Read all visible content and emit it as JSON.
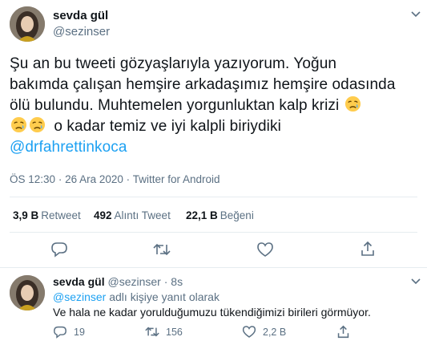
{
  "main_tweet": {
    "display_name": "sevda gül",
    "handle": "@sezinser",
    "text_line1": "Şu an bu tweeti gözyaşlarıyla yazıyorum. Yoğun",
    "text_line2": "bakımda çalışan hemşire arkadaşımız hemşire odasında",
    "text_line3": "ölü bulundu. Muhtemelen yorgunluktan kalp krizi",
    "text_line4": "o kadar temiz ve iyi kalpli biriydiki",
    "mention": "@drfahrettinkoca",
    "time": "ÖS 12:30",
    "sep1": "·",
    "date": "26 Ara 2020",
    "sep2": "·",
    "source": "Twitter for Android",
    "retweets_value": "3,9 B",
    "retweets_label": "Retweet",
    "quotes_value": "492",
    "quotes_label": "Alıntı Tweet",
    "likes_value": "22,1 B",
    "likes_label": "Beğeni",
    "emoji_icon": "sad-but-relieved-face-emoji"
  },
  "reply_tweet": {
    "display_name": "sevda gül",
    "handle": "@sezinser",
    "sep": "·",
    "age": "8s",
    "replying_to_handle": "@sezinser",
    "replying_to_suffix": "adlı kişiye yanıt olarak",
    "text": "Ve hala ne kadar yorulduğumuzu tükendiğimizi birileri görmüyor.",
    "reply_count": "19",
    "retweet_count": "156",
    "like_count": "2,2 B"
  },
  "colors": {
    "accent": "#1da1f2",
    "secondary_text": "#5b7083",
    "divider": "#e6ecf0"
  }
}
